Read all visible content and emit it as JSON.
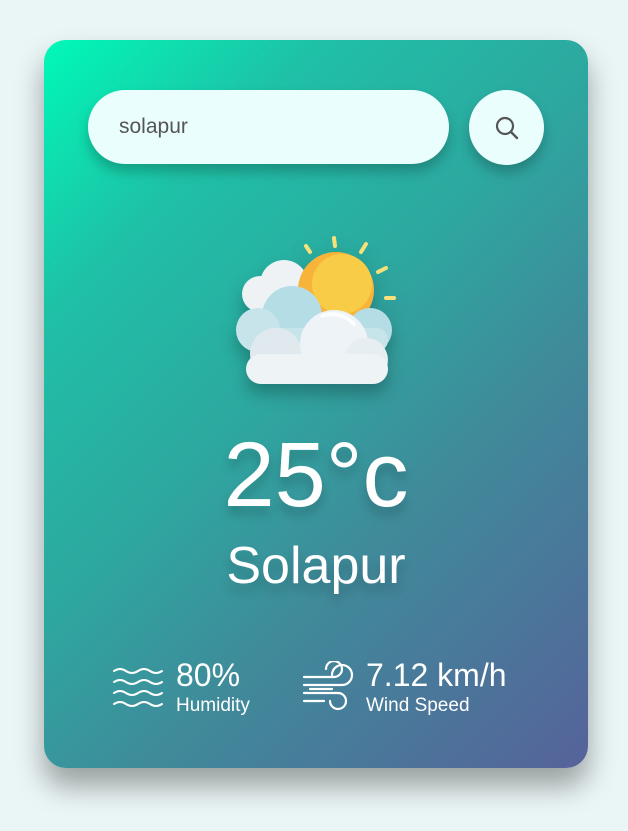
{
  "search": {
    "value": "solapur",
    "button_icon": "search-icon"
  },
  "weather": {
    "icon": "partly-cloudy-sun-icon",
    "temperature": "25°c",
    "city": "Solapur"
  },
  "details": {
    "humidity": {
      "icon": "humidity-waves-icon",
      "value": "80%",
      "label": "Humidity"
    },
    "wind": {
      "icon": "wind-icon",
      "value": "7.12 km/h",
      "label": "Wind Speed"
    }
  },
  "colors": {
    "page_background": "#eaf5f5",
    "card_gradient_start": "#00f9b8",
    "card_gradient_end": "#56629a",
    "input_background": "#ebfefe"
  }
}
